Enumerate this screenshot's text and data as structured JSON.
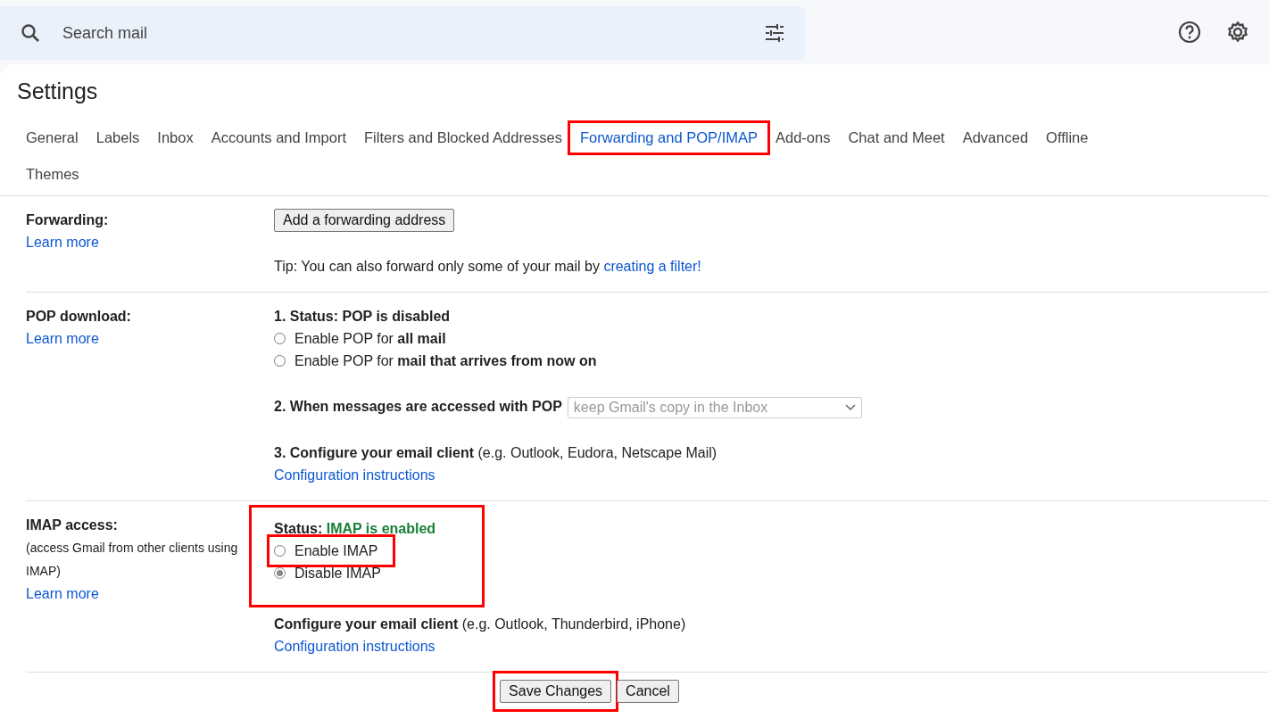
{
  "search": {
    "placeholder": "Search mail"
  },
  "title": "Settings",
  "tabs": [
    {
      "label": "General",
      "selected": false,
      "highlighted": false
    },
    {
      "label": "Labels",
      "selected": false,
      "highlighted": false
    },
    {
      "label": "Inbox",
      "selected": false,
      "highlighted": false
    },
    {
      "label": "Accounts and Import",
      "selected": false,
      "highlighted": false
    },
    {
      "label": "Filters and Blocked Addresses",
      "selected": false,
      "highlighted": false
    },
    {
      "label": "Forwarding and POP/IMAP",
      "selected": true,
      "highlighted": true
    },
    {
      "label": "Add-ons",
      "selected": false,
      "highlighted": false
    },
    {
      "label": "Chat and Meet",
      "selected": false,
      "highlighted": false
    },
    {
      "label": "Advanced",
      "selected": false,
      "highlighted": false
    },
    {
      "label": "Offline",
      "selected": false,
      "highlighted": false
    },
    {
      "label": "Themes",
      "selected": false,
      "highlighted": false
    }
  ],
  "forwarding": {
    "label": "Forwarding:",
    "learn_more": "Learn more",
    "button": "Add a forwarding address",
    "tip": "Tip: You can also forward only some of your mail by",
    "tip_link": "creating a filter!"
  },
  "pop": {
    "label": "POP download:",
    "learn_more": "Learn more",
    "status": "1. Status: POP is disabled",
    "options": [
      {
        "text": "Enable POP for **all mail**",
        "selected": false
      },
      {
        "text": "Enable POP for **mail that arrives from now on**",
        "selected": false
      }
    ],
    "when_label": "2. When messages are accessed with POP",
    "when_select": {
      "value": "keep Gmail's copy in the Inbox",
      "disabled": true
    },
    "configure": "**3. Configure your email client** (e.g. Outlook, Eudora, Netscape Mail)",
    "configure_link": "Configuration instructions"
  },
  "imap": {
    "label": "IMAP access:",
    "note": "(access Gmail from other clients using IMAP)",
    "learn_more": "Learn more",
    "status_label": "Status:",
    "status_value": "IMAP is enabled",
    "status_highlighted": true,
    "options": [
      {
        "text": "Enable IMAP",
        "selected": false,
        "highlighted": true
      },
      {
        "text": "Disable IMAP",
        "selected": true,
        "highlighted": false
      }
    ],
    "configure": "**Configure your email client** (e.g. Outlook, Thunderbird, iPhone)",
    "configure_link": "Configuration instructions"
  },
  "buttons": [
    {
      "label": "Save Changes",
      "highlighted": true
    },
    {
      "label": "Cancel",
      "highlighted": false
    }
  ]
}
